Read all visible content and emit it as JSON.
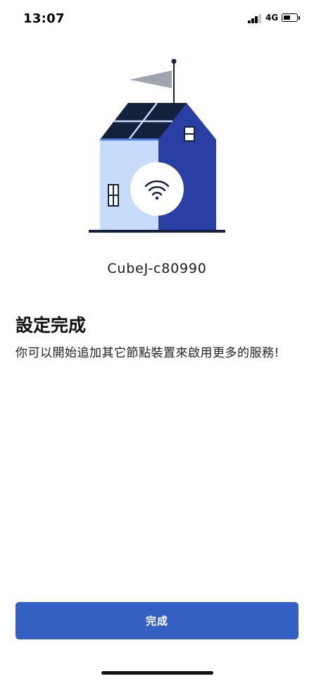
{
  "status_bar": {
    "time": "13:07",
    "network": "4G",
    "signal_bars_active": 3,
    "signal_bars_total": 4,
    "battery_level": 0.55
  },
  "illustration": {
    "icon": "house-wifi-illustration",
    "colors": {
      "roof_panels": "#13213d",
      "house_light": "#c6dcfa",
      "house_dark": "#2a3fa4",
      "flag": "#9ea5af",
      "ground": "#13213d"
    }
  },
  "device": {
    "name": "CubeJ-c80990"
  },
  "content": {
    "title": "設定完成",
    "description": "你可以開始追加其它節點裝置來啟用更多的服務!"
  },
  "actions": {
    "done_label": "完成"
  },
  "theme": {
    "primary": "#3360c2"
  }
}
